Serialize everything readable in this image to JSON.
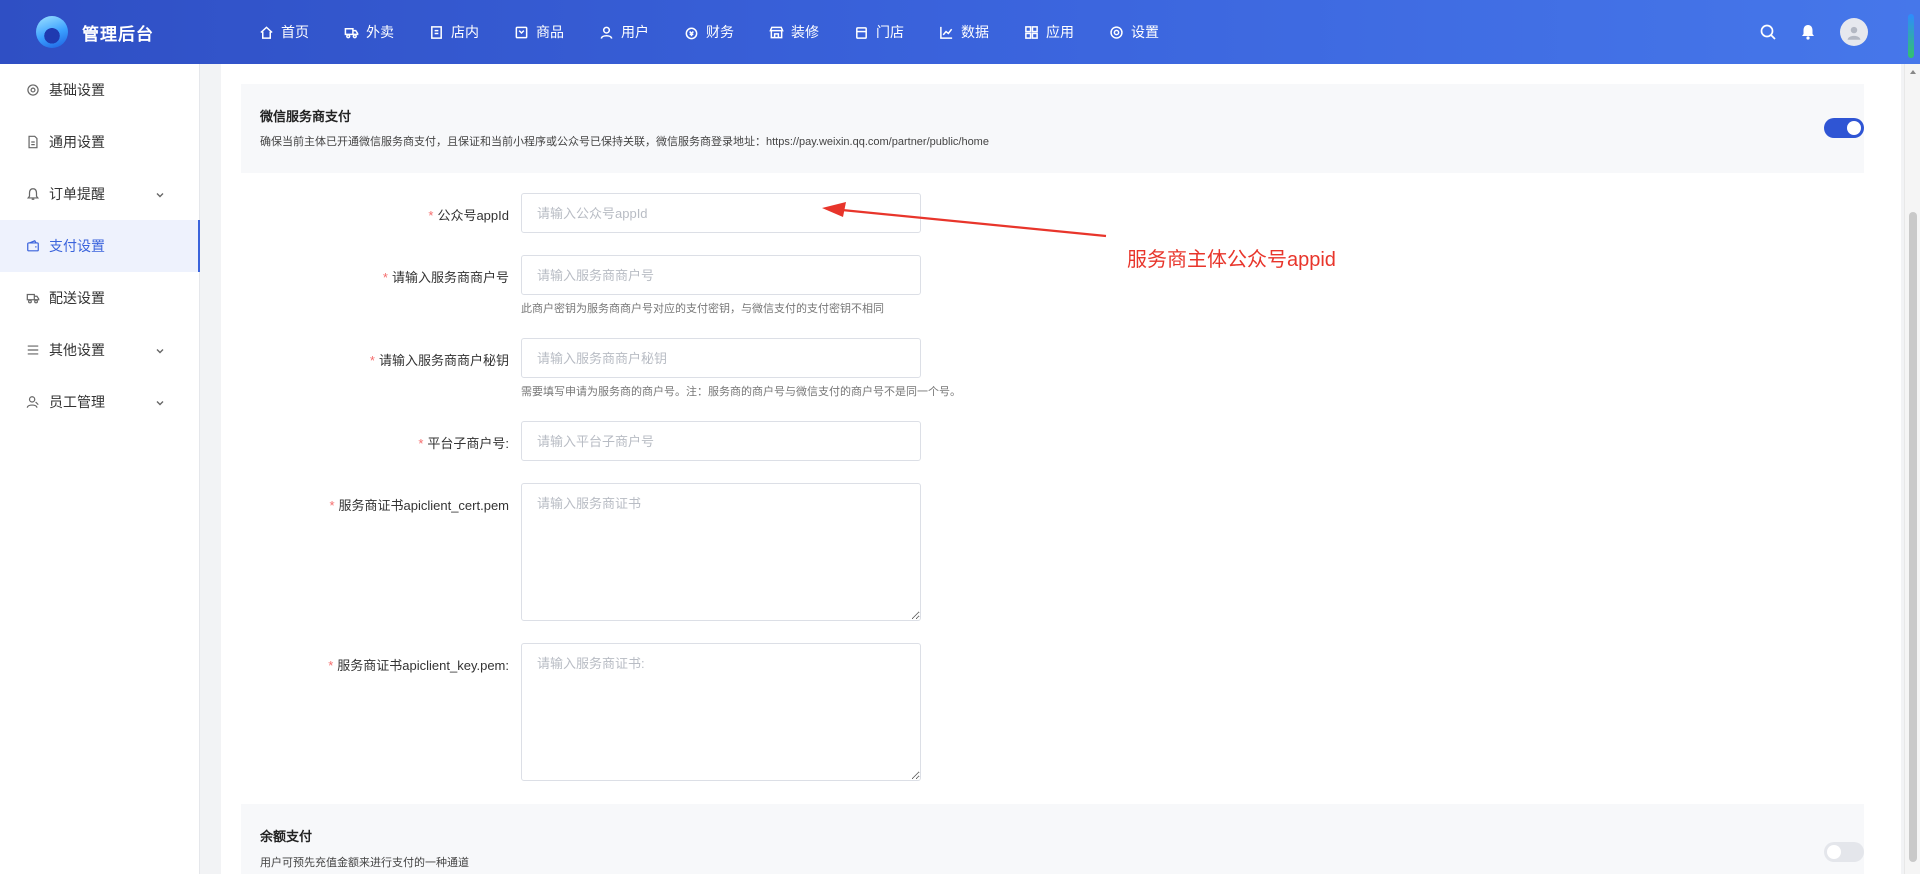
{
  "header": {
    "title": "管理后台",
    "nav": [
      {
        "label": "首页",
        "icon": "home-icon"
      },
      {
        "label": "外卖",
        "icon": "delivery-icon"
      },
      {
        "label": "店内",
        "icon": "store-icon"
      },
      {
        "label": "商品",
        "icon": "goods-icon"
      },
      {
        "label": "用户",
        "icon": "user-icon"
      },
      {
        "label": "财务",
        "icon": "finance-icon"
      },
      {
        "label": "装修",
        "icon": "decorate-icon"
      },
      {
        "label": "门店",
        "icon": "shop-icon"
      },
      {
        "label": "数据",
        "icon": "chart-icon"
      },
      {
        "label": "应用",
        "icon": "apps-icon"
      },
      {
        "label": "设置",
        "icon": "gear-icon"
      }
    ]
  },
  "sidebar": {
    "items": [
      {
        "label": "基础设置",
        "icon": "gear-icon",
        "active": false,
        "expandable": false
      },
      {
        "label": "通用设置",
        "icon": "doc-icon",
        "active": false,
        "expandable": false
      },
      {
        "label": "订单提醒",
        "icon": "bell-icon",
        "active": false,
        "expandable": true
      },
      {
        "label": "支付设置",
        "icon": "wallet-icon",
        "active": true,
        "expandable": false
      },
      {
        "label": "配送设置",
        "icon": "truck-icon",
        "active": false,
        "expandable": false
      },
      {
        "label": "其他设置",
        "icon": "menu-icon",
        "active": false,
        "expandable": true
      },
      {
        "label": "员工管理",
        "icon": "staff-icon",
        "active": false,
        "expandable": true
      }
    ]
  },
  "section": {
    "title": "微信服务商支付",
    "description": "确保当前主体已开通微信服务商支付，且保证和当前小程序或公众号已保持关联，微信服务商登录地址：https://pay.weixin.qq.com/partner/public/home",
    "enabled": true
  },
  "form": {
    "appid": {
      "label": "公众号appId",
      "placeholder": "请输入公众号appId",
      "value": ""
    },
    "mch_id": {
      "label": "请输入服务商商户号",
      "placeholder": "请输入服务商商户号",
      "value": "",
      "help": "此商户密钥为服务商商户号对应的支付密钥，与微信支付的支付密钥不相同"
    },
    "mch_key": {
      "label": "请输入服务商商户秘钥",
      "placeholder": "请输入服务商商户秘钥",
      "value": "",
      "help": "需要填写申请为服务商的商户号。注：服务商的商户号与微信支付的商户号不是同一个号。"
    },
    "sub_mch_id": {
      "label": "平台子商户号:",
      "placeholder": "请输入平台子商户号",
      "value": ""
    },
    "cert": {
      "label": "服务商证书apiclient_cert.pem",
      "placeholder": "请输入服务商证书",
      "value": ""
    },
    "key": {
      "label": "服务商证书apiclient_key.pem:",
      "placeholder": "请输入服务商证书:",
      "value": ""
    }
  },
  "annotation": {
    "text": "服务商主体公众号appid",
    "color": "#e8352b"
  },
  "balance_section": {
    "title": "余额支付",
    "description": "用户可预先充值金额来进行支付的一种通道",
    "enabled": false
  },
  "colors": {
    "accent": "#3a63dc",
    "required": "#f56c6c"
  }
}
